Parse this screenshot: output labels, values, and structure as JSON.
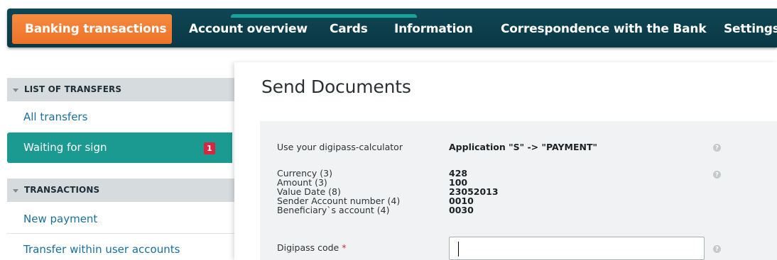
{
  "nav": {
    "items": [
      {
        "label": "Banking transactions",
        "active": true
      },
      {
        "label": "Account overview"
      },
      {
        "label": "Cards"
      },
      {
        "label": "Information"
      },
      {
        "label": "Correspondence with the Bank"
      },
      {
        "label": "Settings"
      }
    ]
  },
  "sidebar": {
    "section1": "LIST OF TRANSFERS",
    "all_transfers": "All transfers",
    "waiting_for_sign": "Waiting for sign",
    "waiting_badge": "1",
    "section2": "TRANSACTIONS",
    "new_payment": "New payment",
    "transfer_within": "Transfer within user accounts"
  },
  "main": {
    "title": "Send Documents",
    "digipass_label": "Use your digipass-calculator",
    "digipass_value": "Application \"S\" -> \"PAYMENT\"",
    "fields": [
      {
        "label": "Currency (3)",
        "value": "428"
      },
      {
        "label": "Amount (3)",
        "value": "100"
      },
      {
        "label": "Value Date (8)",
        "value": "23052013"
      },
      {
        "label": "Sender Account number (4)",
        "value": "0010"
      },
      {
        "label": "Beneficiary`s account (4)",
        "value": "0030"
      }
    ],
    "code_label": "Digipass code",
    "required_mark": "*",
    "code_value": "",
    "help_glyph": "?"
  },
  "colors": {
    "nav_bg": "#0d3f4b",
    "nav_active": "#f07a30",
    "sidebar_active": "#1b9a91",
    "badge": "#d8263f",
    "link": "#1a6f9a"
  },
  "icons": {
    "section_caret": "caret-down-icon",
    "help": "help-icon"
  }
}
